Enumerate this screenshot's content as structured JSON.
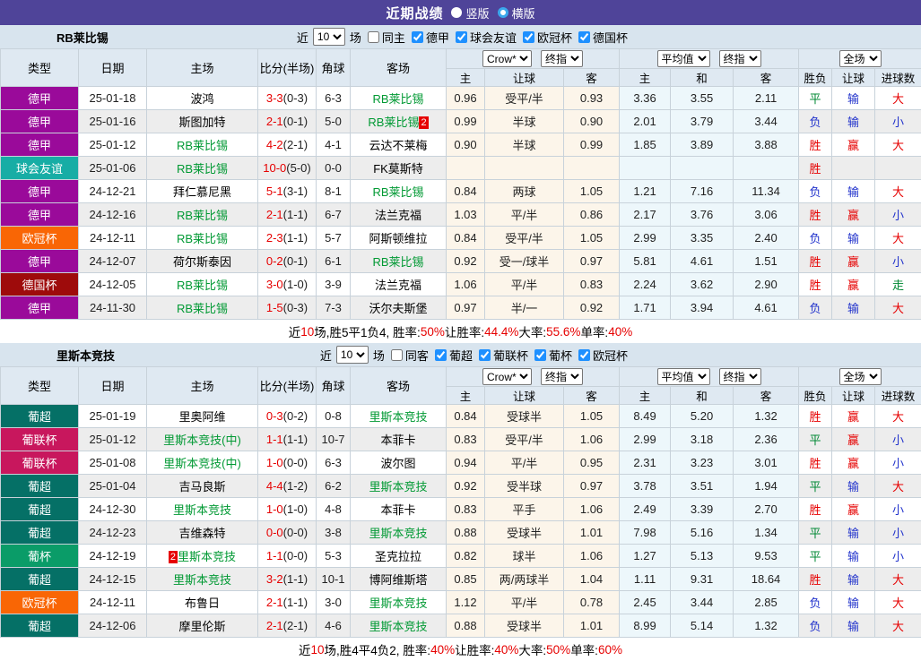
{
  "topbar": {
    "title": "近期战绩",
    "options": [
      {
        "label": "竖版",
        "selected": false
      },
      {
        "label": "横版",
        "selected": true
      }
    ]
  },
  "filter_labels": {
    "near": "近",
    "field": "场"
  },
  "table_headers": {
    "left": [
      "类型",
      "日期",
      "主场",
      "比分(半场)",
      "角球",
      "客场"
    ],
    "odds_cols": [
      "主",
      "让球",
      "客"
    ],
    "avg_cols": [
      "主",
      "和",
      "客"
    ],
    "result_cols": [
      "胜负",
      "让球",
      "进球数"
    ],
    "odds_select": "Crow*",
    "odds_select2": "终指",
    "avg_select": "平均值",
    "avg_select2": "终指",
    "result_select": "全场"
  },
  "type_colors": {
    "德甲": "#9A0A9A",
    "球会友谊": "#17ADA5",
    "欧冠杯": "#F96605",
    "德国杯": "#9E0B0B",
    "葡超": "#057066",
    "葡联杯": "#C8175D",
    "葡杯": "#0A9C68"
  },
  "result_colors": {
    "胜": "#E60000",
    "平": "#008833",
    "负": "#2233CC",
    "赢": "#E60000",
    "输": "#2233CC",
    "大": "#E60000",
    "小": "#2233CC",
    "走": "#008833"
  },
  "colors": {
    "accent_topbar": "#4F4499",
    "section_bar": "#D8E4EE",
    "header_bg": "#DFE9F2",
    "focal_team": "#009933",
    "score_red": "#E60000"
  },
  "sections": [
    {
      "team": "RB莱比锡",
      "filter": {
        "count": "10",
        "same": "同主",
        "same_checked": false,
        "leagues": [
          {
            "label": "德甲",
            "checked": true
          },
          {
            "label": "球会友谊",
            "checked": true
          },
          {
            "label": "欧冠杯",
            "checked": true
          },
          {
            "label": "德国杯",
            "checked": true
          }
        ]
      },
      "rows": [
        {
          "type": "德甲",
          "date": "25-01-18",
          "home": "波鸿",
          "home_focal": false,
          "ft": "3-3",
          "ht": "(0-3)",
          "corner": "6-3",
          "away": "RB莱比锡",
          "away_focal": true,
          "odds": [
            "0.96",
            "受平/半",
            "0.93"
          ],
          "avg": [
            "3.36",
            "3.55",
            "2.11"
          ],
          "results": [
            "平",
            "输",
            "大"
          ]
        },
        {
          "type": "德甲",
          "date": "25-01-16",
          "home": "斯图加特",
          "home_focal": false,
          "ft": "2-1",
          "ht": "(0-1)",
          "corner": "5-0",
          "away": "RB莱比锡",
          "away_focal": true,
          "away_badge": {
            "text": "2",
            "pos": "after"
          },
          "odds": [
            "0.99",
            "半球",
            "0.90"
          ],
          "avg": [
            "2.01",
            "3.79",
            "3.44"
          ],
          "results": [
            "负",
            "输",
            "小"
          ]
        },
        {
          "type": "德甲",
          "date": "25-01-12",
          "home": "RB莱比锡",
          "home_focal": true,
          "ft": "4-2",
          "ht": "(2-1)",
          "corner": "4-1",
          "away": "云达不莱梅",
          "away_focal": false,
          "odds": [
            "0.90",
            "半球",
            "0.99"
          ],
          "avg": [
            "1.85",
            "3.89",
            "3.88"
          ],
          "results": [
            "胜",
            "赢",
            "大"
          ]
        },
        {
          "type": "球会友谊",
          "date": "25-01-06",
          "home": "RB莱比锡",
          "home_focal": true,
          "ft": "10-0",
          "ht": "(5-0)",
          "corner": "0-0",
          "away": "FK莫斯特",
          "away_focal": false,
          "odds": [
            "",
            "",
            ""
          ],
          "avg": [
            "",
            "",
            ""
          ],
          "results": [
            "胜",
            "",
            ""
          ]
        },
        {
          "type": "德甲",
          "date": "24-12-21",
          "home": "拜仁慕尼黑",
          "home_focal": false,
          "ft": "5-1",
          "ht": "(3-1)",
          "corner": "8-1",
          "away": "RB莱比锡",
          "away_focal": true,
          "odds": [
            "0.84",
            "两球",
            "1.05"
          ],
          "avg": [
            "1.21",
            "7.16",
            "11.34"
          ],
          "results": [
            "负",
            "输",
            "大"
          ]
        },
        {
          "type": "德甲",
          "date": "24-12-16",
          "home": "RB莱比锡",
          "home_focal": true,
          "ft": "2-1",
          "ht": "(1-1)",
          "corner": "6-7",
          "away": "法兰克福",
          "away_focal": false,
          "odds": [
            "1.03",
            "平/半",
            "0.86"
          ],
          "avg": [
            "2.17",
            "3.76",
            "3.06"
          ],
          "results": [
            "胜",
            "赢",
            "小"
          ]
        },
        {
          "type": "欧冠杯",
          "date": "24-12-11",
          "home": "RB莱比锡",
          "home_focal": true,
          "ft": "2-3",
          "ht": "(1-1)",
          "corner": "5-7",
          "away": "阿斯顿维拉",
          "away_focal": false,
          "odds": [
            "0.84",
            "受平/半",
            "1.05"
          ],
          "avg": [
            "2.99",
            "3.35",
            "2.40"
          ],
          "results": [
            "负",
            "输",
            "大"
          ]
        },
        {
          "type": "德甲",
          "date": "24-12-07",
          "home": "荷尔斯泰因",
          "home_focal": false,
          "ft": "0-2",
          "ht": "(0-1)",
          "corner": "6-1",
          "away": "RB莱比锡",
          "away_focal": true,
          "odds": [
            "0.92",
            "受一/球半",
            "0.97"
          ],
          "avg": [
            "5.81",
            "4.61",
            "1.51"
          ],
          "results": [
            "胜",
            "赢",
            "小"
          ]
        },
        {
          "type": "德国杯",
          "date": "24-12-05",
          "home": "RB莱比锡",
          "home_focal": true,
          "ft": "3-0",
          "ht": "(1-0)",
          "corner": "3-9",
          "away": "法兰克福",
          "away_focal": false,
          "odds": [
            "1.06",
            "平/半",
            "0.83"
          ],
          "avg": [
            "2.24",
            "3.62",
            "2.90"
          ],
          "results": [
            "胜",
            "赢",
            "走"
          ]
        },
        {
          "type": "德甲",
          "date": "24-11-30",
          "home": "RB莱比锡",
          "home_focal": true,
          "ft": "1-5",
          "ht": "(0-3)",
          "corner": "7-3",
          "away": "沃尔夫斯堡",
          "away_focal": false,
          "odds": [
            "0.97",
            "半/一",
            "0.92"
          ],
          "avg": [
            "1.71",
            "3.94",
            "4.61"
          ],
          "results": [
            "负",
            "输",
            "大"
          ]
        }
      ],
      "summary": [
        {
          "t": "近"
        },
        {
          "t": "10",
          "r": true
        },
        {
          "t": "场,胜5平1负4, 胜率:"
        },
        {
          "t": "50%",
          "r": true
        },
        {
          "t": " 让胜率:"
        },
        {
          "t": "44.4%",
          "r": true
        },
        {
          "t": " 大率:"
        },
        {
          "t": "55.6%",
          "r": true
        },
        {
          "t": " 单率:"
        },
        {
          "t": "40%",
          "r": true
        }
      ]
    },
    {
      "team": "里斯本竞技",
      "filter": {
        "count": "10",
        "same": "同客",
        "same_checked": false,
        "leagues": [
          {
            "label": "葡超",
            "checked": true
          },
          {
            "label": "葡联杯",
            "checked": true
          },
          {
            "label": "葡杯",
            "checked": true
          },
          {
            "label": "欧冠杯",
            "checked": true
          }
        ]
      },
      "rows": [
        {
          "type": "葡超",
          "date": "25-01-19",
          "home": "里奥阿维",
          "home_focal": false,
          "ft": "0-3",
          "ht": "(0-2)",
          "corner": "0-8",
          "away": "里斯本竞技",
          "away_focal": true,
          "odds": [
            "0.84",
            "受球半",
            "1.05"
          ],
          "avg": [
            "8.49",
            "5.20",
            "1.32"
          ],
          "results": [
            "胜",
            "赢",
            "大"
          ]
        },
        {
          "type": "葡联杯",
          "date": "25-01-12",
          "home": "里斯本竞技(中)",
          "home_focal": true,
          "ft": "1-1",
          "ht": "(1-1)",
          "corner": "10-7",
          "away": "本菲卡",
          "away_focal": false,
          "odds": [
            "0.83",
            "受平/半",
            "1.06"
          ],
          "avg": [
            "2.99",
            "3.18",
            "2.36"
          ],
          "results": [
            "平",
            "赢",
            "小"
          ]
        },
        {
          "type": "葡联杯",
          "date": "25-01-08",
          "home": "里斯本竞技(中)",
          "home_focal": true,
          "ft": "1-0",
          "ht": "(0-0)",
          "corner": "6-3",
          "away": "波尔图",
          "away_focal": false,
          "odds": [
            "0.94",
            "平/半",
            "0.95"
          ],
          "avg": [
            "2.31",
            "3.23",
            "3.01"
          ],
          "results": [
            "胜",
            "赢",
            "小"
          ]
        },
        {
          "type": "葡超",
          "date": "25-01-04",
          "home": "吉马良斯",
          "home_focal": false,
          "ft": "4-4",
          "ht": "(1-2)",
          "corner": "6-2",
          "away": "里斯本竞技",
          "away_focal": true,
          "odds": [
            "0.92",
            "受半球",
            "0.97"
          ],
          "avg": [
            "3.78",
            "3.51",
            "1.94"
          ],
          "results": [
            "平",
            "输",
            "大"
          ]
        },
        {
          "type": "葡超",
          "date": "24-12-30",
          "home": "里斯本竞技",
          "home_focal": true,
          "ft": "1-0",
          "ht": "(1-0)",
          "corner": "4-8",
          "away": "本菲卡",
          "away_focal": false,
          "odds": [
            "0.83",
            "平手",
            "1.06"
          ],
          "avg": [
            "2.49",
            "3.39",
            "2.70"
          ],
          "results": [
            "胜",
            "赢",
            "小"
          ]
        },
        {
          "type": "葡超",
          "date": "24-12-23",
          "home": "吉维森特",
          "home_focal": false,
          "ft": "0-0",
          "ht": "(0-0)",
          "corner": "3-8",
          "away": "里斯本竞技",
          "away_focal": true,
          "odds": [
            "0.88",
            "受球半",
            "1.01"
          ],
          "avg": [
            "7.98",
            "5.16",
            "1.34"
          ],
          "results": [
            "平",
            "输",
            "小"
          ]
        },
        {
          "type": "葡杯",
          "date": "24-12-19",
          "home": "里斯本竞技",
          "home_focal": true,
          "home_badge": {
            "text": "2",
            "pos": "before"
          },
          "ft": "1-1",
          "ht": "(0-0)",
          "corner": "5-3",
          "away": "圣克拉拉",
          "away_focal": false,
          "odds": [
            "0.82",
            "球半",
            "1.06"
          ],
          "avg": [
            "1.27",
            "5.13",
            "9.53"
          ],
          "results": [
            "平",
            "输",
            "小"
          ]
        },
        {
          "type": "葡超",
          "date": "24-12-15",
          "home": "里斯本竞技",
          "home_focal": true,
          "ft": "3-2",
          "ht": "(1-1)",
          "corner": "10-1",
          "away": "博阿维斯塔",
          "away_focal": false,
          "odds": [
            "0.85",
            "两/两球半",
            "1.04"
          ],
          "avg": [
            "1.11",
            "9.31",
            "18.64"
          ],
          "results": [
            "胜",
            "输",
            "大"
          ]
        },
        {
          "type": "欧冠杯",
          "date": "24-12-11",
          "home": "布鲁日",
          "home_focal": false,
          "ft": "2-1",
          "ht": "(1-1)",
          "corner": "3-0",
          "away": "里斯本竞技",
          "away_focal": true,
          "odds": [
            "1.12",
            "平/半",
            "0.78"
          ],
          "avg": [
            "2.45",
            "3.44",
            "2.85"
          ],
          "results": [
            "负",
            "输",
            "大"
          ]
        },
        {
          "type": "葡超",
          "date": "24-12-06",
          "home": "摩里伦斯",
          "home_focal": false,
          "ft": "2-1",
          "ht": "(2-1)",
          "corner": "4-6",
          "away": "里斯本竞技",
          "away_focal": true,
          "odds": [
            "0.88",
            "受球半",
            "1.01"
          ],
          "avg": [
            "8.99",
            "5.14",
            "1.32"
          ],
          "results": [
            "负",
            "输",
            "大"
          ]
        }
      ],
      "summary": [
        {
          "t": "近"
        },
        {
          "t": "10",
          "r": true
        },
        {
          "t": "场,胜4平4负2, 胜率:"
        },
        {
          "t": "40%",
          "r": true
        },
        {
          "t": " 让胜率:"
        },
        {
          "t": "40%",
          "r": true
        },
        {
          "t": " 大率:"
        },
        {
          "t": "50%",
          "r": true
        },
        {
          "t": " 单率:"
        },
        {
          "t": "60%",
          "r": true
        }
      ]
    }
  ]
}
